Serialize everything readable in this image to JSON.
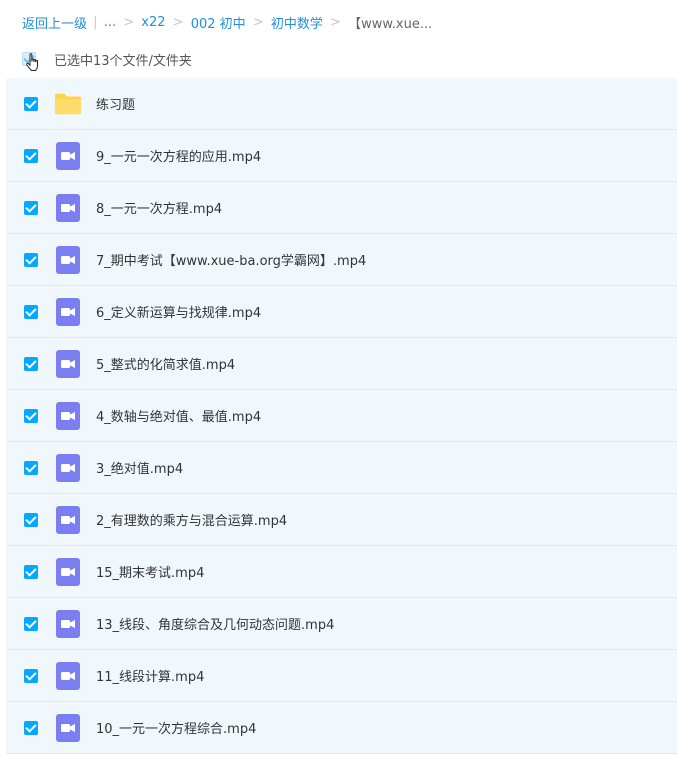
{
  "breadcrumb": {
    "back": "返回上一级",
    "sep_bar": "|",
    "ellipsis": "...",
    "sep": ">",
    "items": [
      "x22",
      "002 初中",
      "初中数学"
    ],
    "current": "【www.xue..."
  },
  "selection": {
    "label": "已选中13个文件/文件夹"
  },
  "files": [
    {
      "name": "练习题",
      "type": "folder"
    },
    {
      "name": "9_一元一次方程的应用.mp4",
      "type": "video"
    },
    {
      "name": "8_一元一次方程.mp4",
      "type": "video"
    },
    {
      "name": "7_期中考试【www.xue-ba.org学霸网】.mp4",
      "type": "video"
    },
    {
      "name": "6_定义新运算与找规律.mp4",
      "type": "video"
    },
    {
      "name": "5_整式的化简求值.mp4",
      "type": "video"
    },
    {
      "name": "4_数轴与绝对值、最值.mp4",
      "type": "video"
    },
    {
      "name": "3_绝对值.mp4",
      "type": "video"
    },
    {
      "name": "2_有理数的乘方与混合运算.mp4",
      "type": "video"
    },
    {
      "name": "15_期末考试.mp4",
      "type": "video"
    },
    {
      "name": "13_线段、角度综合及几何动态问题.mp4",
      "type": "video"
    },
    {
      "name": "11_线段计算.mp4",
      "type": "video"
    },
    {
      "name": "10_一元一次方程综合.mp4",
      "type": "video"
    }
  ],
  "colors": {
    "accent": "#06a7ff",
    "row_bg": "#f1f8fd",
    "video_icon": "#7b7ef0",
    "folder_icon": "#ffd24d"
  }
}
